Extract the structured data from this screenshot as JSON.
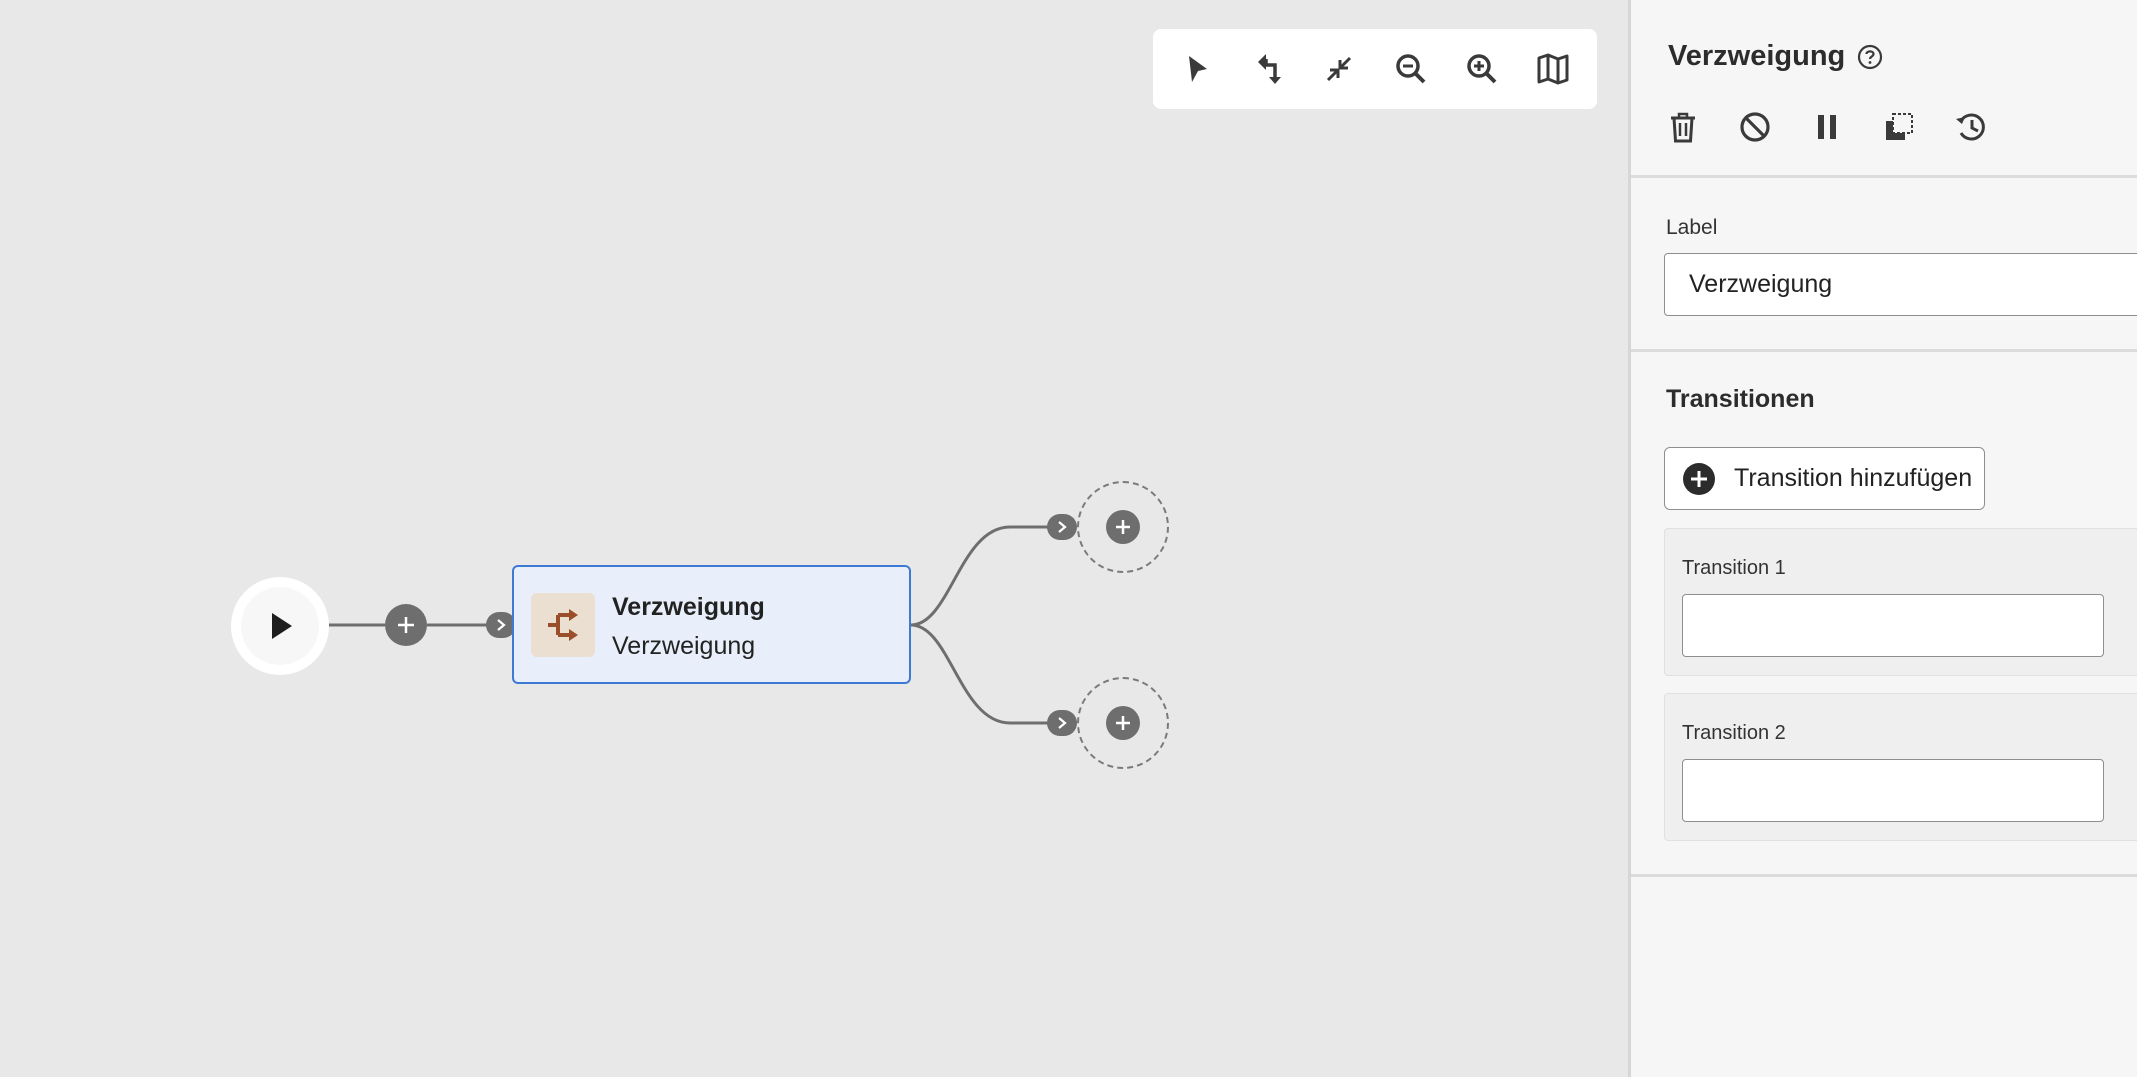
{
  "canvas": {
    "toolbar": [
      {
        "name": "select-tool-button",
        "icon": "pointer-icon"
      },
      {
        "name": "route-tool-button",
        "icon": "route-arrows-icon"
      },
      {
        "name": "collapse-button",
        "icon": "collapse-icon"
      },
      {
        "name": "zoom-out-button",
        "icon": "zoom-out-icon"
      },
      {
        "name": "zoom-in-button",
        "icon": "zoom-in-icon"
      },
      {
        "name": "minimap-button",
        "icon": "map-icon"
      }
    ],
    "node": {
      "title": "Verzweigung",
      "subtitle": "Verzweigung",
      "icon": "branch-icon",
      "icon_color": "#9a4f2a"
    }
  },
  "panel": {
    "title": "Verzweigung",
    "actions": [
      {
        "name": "delete-button",
        "icon": "trash-icon"
      },
      {
        "name": "disable-button",
        "icon": "block-icon"
      },
      {
        "name": "pause-button",
        "icon": "pause-icon"
      },
      {
        "name": "duplicate-button",
        "icon": "copy-icon"
      },
      {
        "name": "history-button",
        "icon": "history-icon"
      }
    ],
    "label_field": {
      "label": "Label",
      "value": "Verzweigung"
    },
    "transitions_title": "Transitionen",
    "add_transition_label": "Transition hinzufügen",
    "transitions": [
      {
        "label": "Transition 1",
        "value": ""
      },
      {
        "label": "Transition 2",
        "value": ""
      }
    ]
  },
  "colors": {
    "canvas_bg": "#e8e8e8",
    "node_bg": "#e9effa",
    "node_border": "#3d7ad6",
    "connector": "#6e6e6e"
  }
}
